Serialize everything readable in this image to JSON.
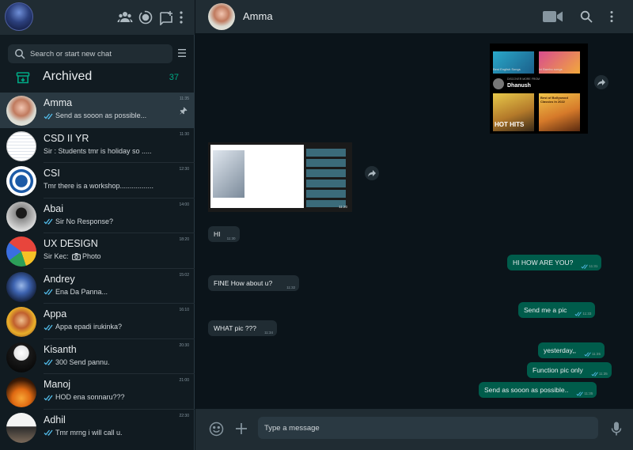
{
  "sidebar": {
    "search_placeholder": "Search or start new chat",
    "archived": {
      "label": "Archived",
      "count": "37"
    },
    "chats": [
      {
        "name": "Amma",
        "time": "11:35",
        "preview": "Send as sooon as possible...",
        "ticks": true,
        "pinned": true,
        "active": true
      },
      {
        "name": "CSD II YR",
        "time": "11:30",
        "preview": "Sir : Students tmr is holiday so ....."
      },
      {
        "name": "CSI",
        "time": "12:30",
        "preview": "Tmr there is a workshop................."
      },
      {
        "name": "Abai",
        "time": "14:00",
        "preview": "Sir No Response?",
        "ticks": true
      },
      {
        "name": "UX DESIGN",
        "time": "18:20",
        "preview_prefix": "Sir Kec:",
        "preview": "Photo",
        "photo": true
      },
      {
        "name": "Andrey",
        "time": "15:02",
        "preview": "Ena Da Panna...",
        "ticks": true
      },
      {
        "name": "Appa",
        "time": "16:10",
        "preview": "Appa epadi irukinka?",
        "ticks": true
      },
      {
        "name": "Kisanth",
        "time": "20:30",
        "preview": "300 Send pannu.",
        "ticks": true
      },
      {
        "name": "Manoj",
        "time": "21:00",
        "preview": "HOD ena sonnaru???",
        "ticks": true
      },
      {
        "name": "Adhil",
        "time": "22:30",
        "preview": "Tmr mrng i will call u.",
        "ticks": true
      }
    ]
  },
  "header": {
    "contact_name": "Amma"
  },
  "messages": [
    {
      "dir": "in",
      "text": "HI",
      "time": "11:30"
    },
    {
      "dir": "out",
      "text": "HI HOW ARE YOU?",
      "time": "11:31"
    },
    {
      "dir": "in",
      "text": "FINE How about u?",
      "time": "11:32"
    },
    {
      "dir": "out",
      "text": "Send me a pic",
      "time": "11:33"
    },
    {
      "dir": "in",
      "text": "WHAT pic ???",
      "time": "11:34"
    },
    {
      "dir": "out",
      "text": "yesterday,,",
      "time": "11:35"
    },
    {
      "dir": "out",
      "text": "Function pic only",
      "time": "11:35"
    },
    {
      "dir": "out",
      "text": "Send as sooon as possible..",
      "time": "11:35"
    }
  ],
  "media": {
    "image1": {
      "tile1": "Best English Songs",
      "tile2": "Ivi Bambu songs",
      "section": "DISCOVER MORE FROM",
      "artist": "Dhanush",
      "tile3": "HOT HITS",
      "tile4": "Best of Bollywood Classics In 2022"
    },
    "image2_time": "11:20"
  },
  "composer": {
    "placeholder": "Type a message"
  },
  "colors": {
    "accent": "#00a884",
    "outgoing": "#005c4b",
    "incoming": "#202c33",
    "tick": "#53bdeb"
  }
}
